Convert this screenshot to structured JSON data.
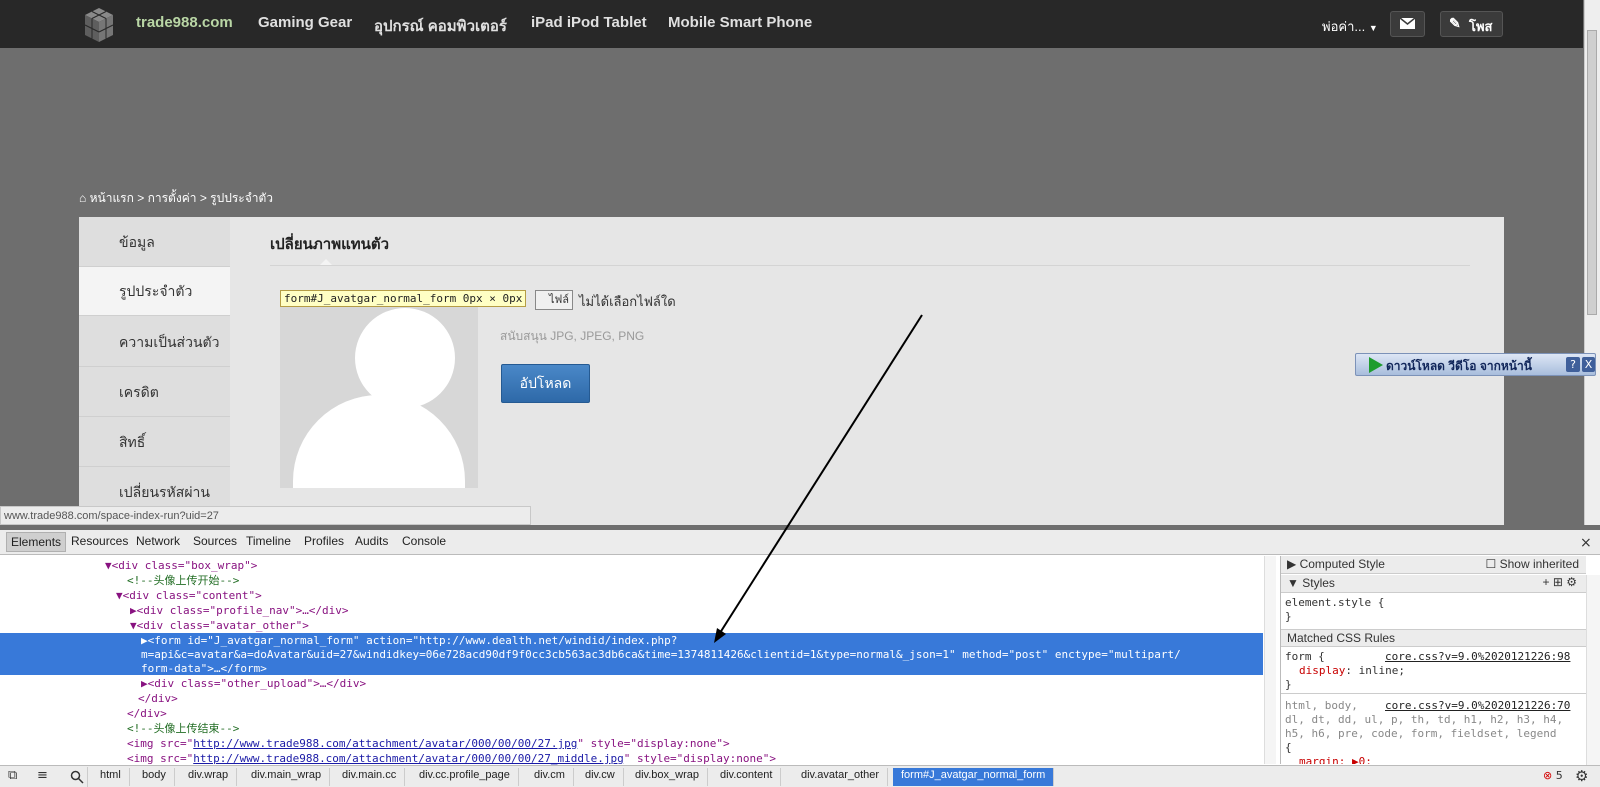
{
  "header": {
    "site_name": "trade988.com",
    "nav": [
      "Gaming Gear",
      "อุปกรณ์ คอมพิวเตอร์",
      "iPad iPod Tablet",
      "Mobile Smart Phone"
    ],
    "user_label": "พ่อค่า...",
    "post_label": "โพส"
  },
  "breadcrumb": {
    "home": "หน้าแรก",
    "settings": "การตั้งค่า",
    "current": "รูปประจำตัว"
  },
  "sidebar": {
    "items": [
      {
        "label": "ข้อมูล"
      },
      {
        "label": "รูปประจำตัว",
        "active": true
      },
      {
        "label": "ความเป็นส่วนตัว"
      },
      {
        "label": "เครดิต"
      },
      {
        "label": "สิทธิ์"
      },
      {
        "label": "เปลี่ยนรหัสผ่าน"
      }
    ]
  },
  "main": {
    "title": "เปลี่ยนภาพแทนตัว",
    "tooltip": "form#J_avatgar_normal_form 0px × 0px",
    "choose_file": "ไฟล์",
    "no_file": "ไม่ได้เลือกไฟล์ใด",
    "support": "สนับสนุน JPG, JPEG, PNG",
    "upload": "อัปโหลด"
  },
  "video_bar": {
    "label": "ดาวน์โหลด วีดีโอ จากหน้านี้",
    "help": "?",
    "close": "X"
  },
  "status_url": "www.trade988.com/space-index-run?uid=27",
  "devtools": {
    "tabs": [
      "Elements",
      "Resources",
      "Network",
      "Sources",
      "Timeline",
      "Profiles",
      "Audits",
      "Console"
    ],
    "active_tab": "Elements",
    "close": "×",
    "dom": {
      "l1": "<div class=\"box_wrap\">",
      "l2": "<!--头像上传开始-->",
      "l3": "<div class=\"content\">",
      "l4": "<div class=\"profile_nav\">…</div>",
      "l5": "<div class=\"avatar_other\">",
      "l6": "<form id=\"J_avatgar_normal_form\" action=\"http://www.dealth.net/windid/index.php?",
      "l7": "m=api&c=avatar&a=doAvatar&uid=27&windidkey=06e728acd90df9f0cc3cb563ac3db6ca&time=1374811426&clientid=1&type=normal&_json=1\" method=\"post\" enctype=\"multipart/",
      "l8": "form-data\">…</form>",
      "l9": "<div class=\"other_upload\">…</div>",
      "l10": "</div>",
      "l11": "</div>",
      "l12": "<!--头像上传结束-->",
      "l13_pre": "<img src=\"",
      "l13_link": "http://www.trade988.com/attachment/avatar/000/00/00/27.jpg",
      "l13_post": "\" style=\"display:none\">",
      "l14_pre": "<img src=\"",
      "l14_link": "http://www.trade988.com/attachment/avatar/000/00/00/27_middle.jpg",
      "l14_post": "\" style=\"display:none\">"
    },
    "styles": {
      "computed": "Computed Style",
      "show_inherited": "Show inherited",
      "styles_head": "Styles",
      "element_style": "element.style {",
      "close_brace": "}",
      "matched": "Matched CSS Rules",
      "rule1_sel": "form {",
      "rule1_src": "core.css?v=9.0%2020121226:98",
      "rule1_prop": "display",
      "rule1_val": "inline;",
      "rule2_sel": "html, body,",
      "rule2_src": "core.css?v=9.0%2020121226:70",
      "rule2_l2": "dl, dt, dd, ul, p, th, td, h1, h2, h3, h4,",
      "rule2_l3": "h5, h6, pre, code, form, fieldset, legend",
      "rule2_l4": "{",
      "rule2_l5": "margin: ▶0;"
    },
    "breadcrumbs": [
      "html",
      "body",
      "div.wrap",
      "div.main_wrap",
      "div.main.cc",
      "div.cc.profile_page",
      "div.cm",
      "div.cw",
      "div.box_wrap",
      "div.content",
      "div.avatar_other",
      "form#J_avatgar_normal_form"
    ],
    "error_count": "5"
  }
}
